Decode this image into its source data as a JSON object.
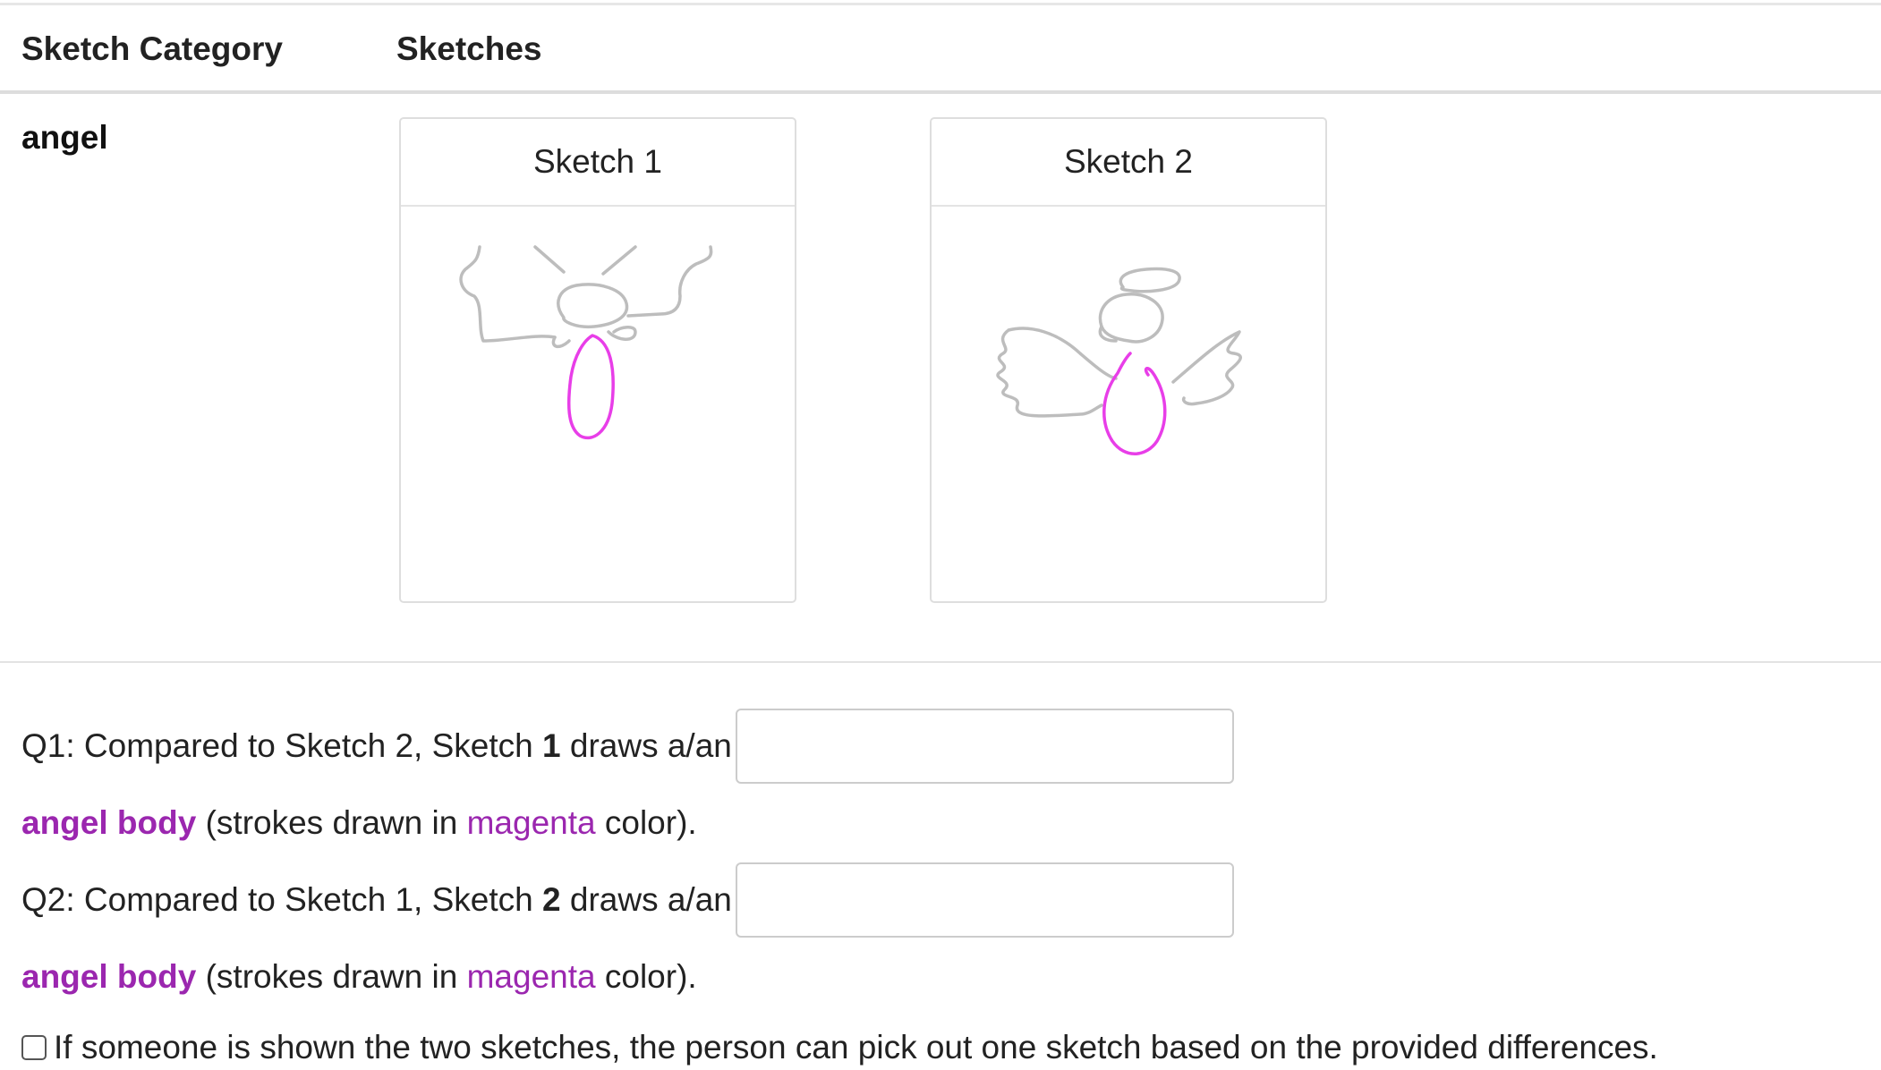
{
  "table": {
    "header_category": "Sketch Category",
    "header_sketches": "Sketches"
  },
  "category": "angel",
  "sketches": [
    {
      "title": "Sketch 1"
    },
    {
      "title": "Sketch 2"
    }
  ],
  "colors": {
    "highlight_stroke": "#e83ee8",
    "context_stroke": "#bdbdbd",
    "part_text": "#9b27af"
  },
  "q1": {
    "prefix": "Q1: Compared to Sketch 2, Sketch ",
    "number": "1",
    "suffix": " draws a/an",
    "value": "",
    "part": "angel body",
    "desc_a": " (strokes drawn in ",
    "color_word": "magenta",
    "desc_b": " color)."
  },
  "q2": {
    "prefix": "Q2: Compared to Sketch 1, Sketch ",
    "number": "2",
    "suffix": " draws a/an",
    "value": "",
    "part": "angel body",
    "desc_a": " (strokes drawn in ",
    "color_word": "magenta",
    "desc_b": " color)."
  },
  "confirm": {
    "checked": false,
    "label": "If someone is shown the two sketches, the person can pick out one sketch based on the provided differences."
  }
}
